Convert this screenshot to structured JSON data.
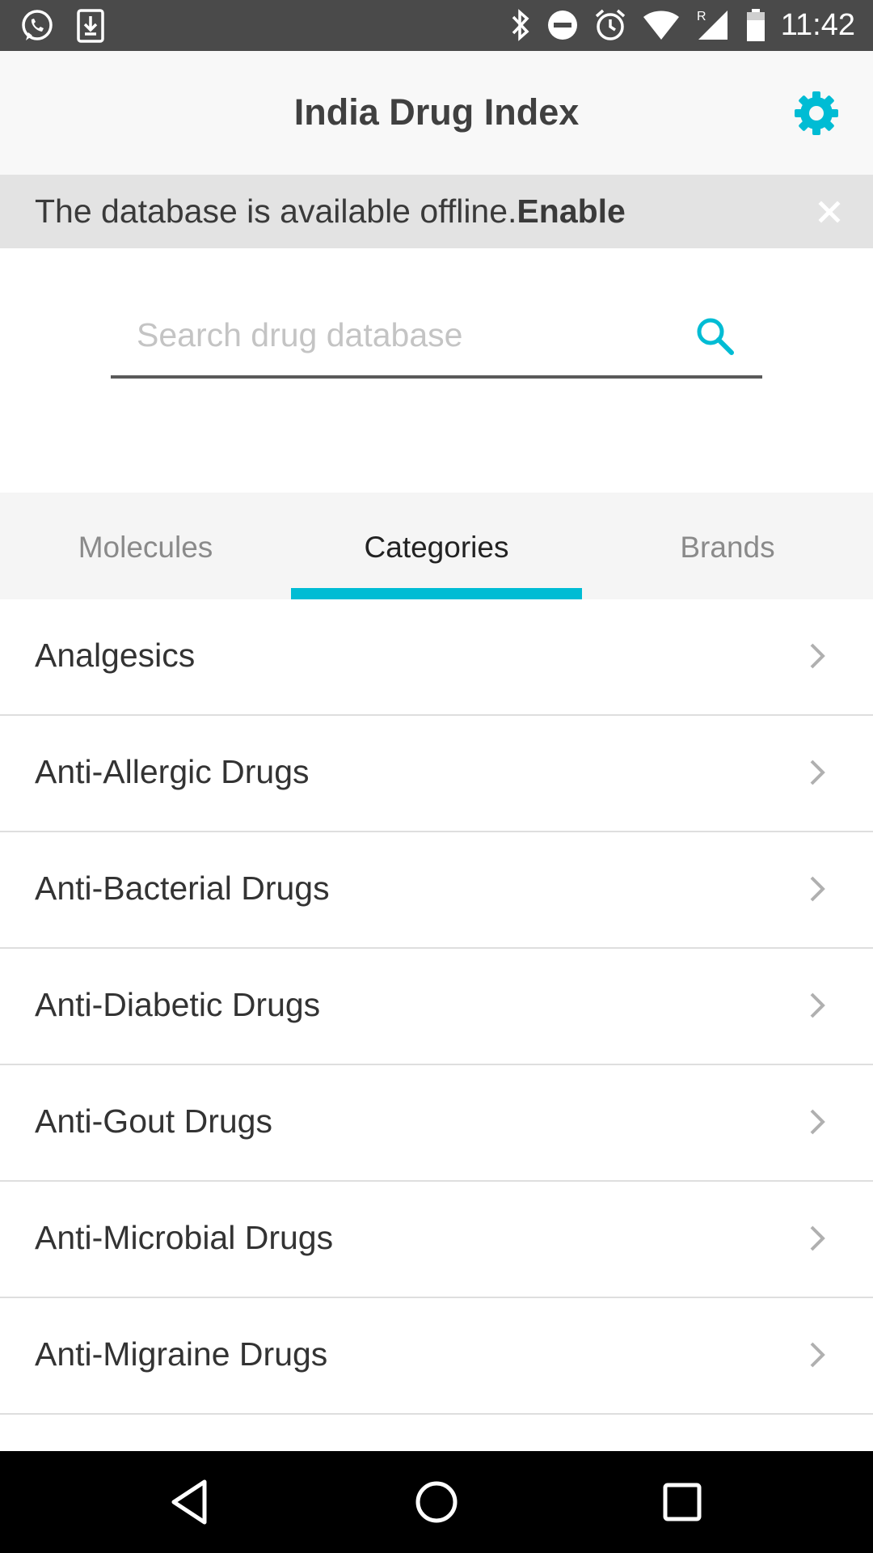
{
  "status_bar": {
    "time": "11:42",
    "icons_left": [
      "whatsapp-icon",
      "download-icon"
    ],
    "icons_right": [
      "bluetooth-icon",
      "do-not-disturb-icon",
      "alarm-icon",
      "wifi-icon",
      "signal-icon",
      "battery-icon"
    ]
  },
  "app_bar": {
    "title": "India Drug Index",
    "settings_icon": "gear-icon",
    "accent": "#00bcd4"
  },
  "banner": {
    "message": "The database is available offline.",
    "action": "Enable",
    "close_icon": "close-icon"
  },
  "search": {
    "placeholder": "Search drug database",
    "value": ""
  },
  "tabs": [
    {
      "label": "Molecules",
      "active": false
    },
    {
      "label": "Categories",
      "active": true
    },
    {
      "label": "Brands",
      "active": false
    }
  ],
  "categories": [
    {
      "label": "Analgesics"
    },
    {
      "label": "Anti-Allergic Drugs"
    },
    {
      "label": "Anti-Bacterial Drugs"
    },
    {
      "label": "Anti-Diabetic Drugs"
    },
    {
      "label": "Anti-Gout Drugs"
    },
    {
      "label": "Anti-Microbial Drugs"
    },
    {
      "label": "Anti-Migraine Drugs"
    }
  ],
  "nav_bar": [
    "back-icon",
    "home-icon",
    "recents-icon"
  ]
}
